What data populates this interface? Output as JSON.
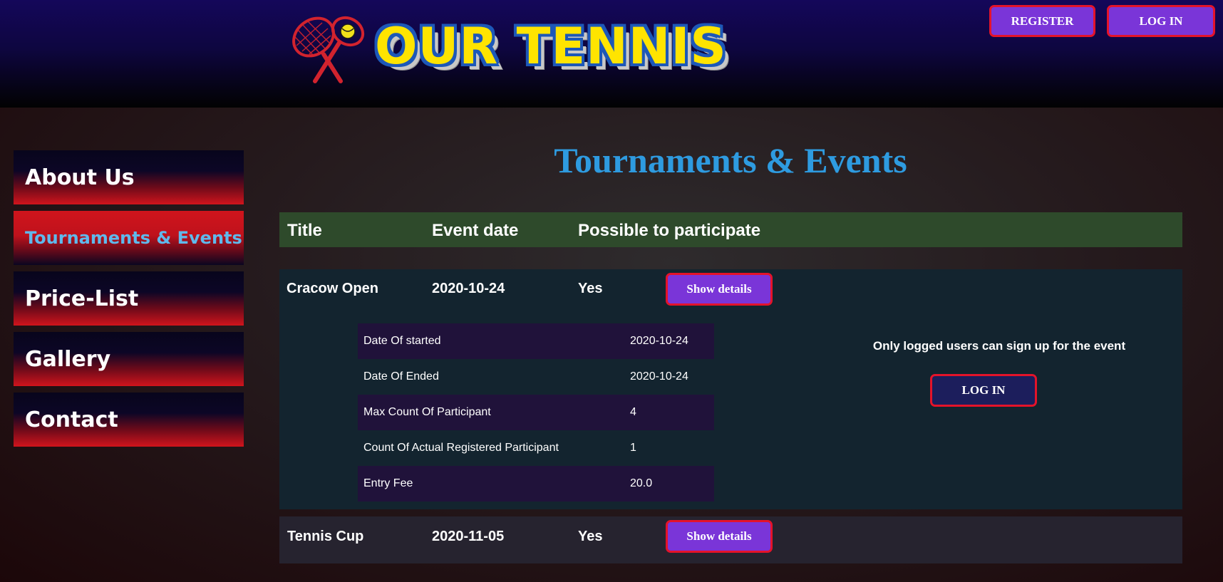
{
  "header": {
    "logo_text": "OUR TENNIS",
    "register_label": "REGISTER",
    "login_label": "LOG IN"
  },
  "sidebar": {
    "items": [
      {
        "label": "About Us"
      },
      {
        "label": "Tournaments & Events",
        "active": true
      },
      {
        "label": "Price-List"
      },
      {
        "label": "Gallery"
      },
      {
        "label": "Contact"
      }
    ]
  },
  "main": {
    "title": "Tournaments & Events",
    "columns": [
      "Title",
      "Event date",
      "Possible to participate"
    ],
    "events": [
      {
        "title": "Cracow Open",
        "date": "2020-10-24",
        "possible": "Yes",
        "button": "Show details",
        "details": [
          {
            "key": "Date Of started",
            "value": "2020-10-24"
          },
          {
            "key": "Date Of Ended",
            "value": "2020-10-24"
          },
          {
            "key": "Max Count Of Participant",
            "value": "4"
          },
          {
            "key": "Count Of Actual Registered Participant",
            "value": "1"
          },
          {
            "key": "Entry Fee",
            "value": "20.0"
          }
        ],
        "login_note": "Only logged users can sign up for the event",
        "login_button": "LOG IN"
      },
      {
        "title": "Tennis Cup",
        "date": "2020-11-05",
        "possible": "Yes",
        "button": "Show details"
      }
    ]
  },
  "colors": {
    "accent_purple": "#7a35d8",
    "button_border_red": "#e4132a",
    "title_blue": "#2e9be0",
    "active_nav_text": "#5fb9ec",
    "table_header_green": "#2e4a2b"
  }
}
